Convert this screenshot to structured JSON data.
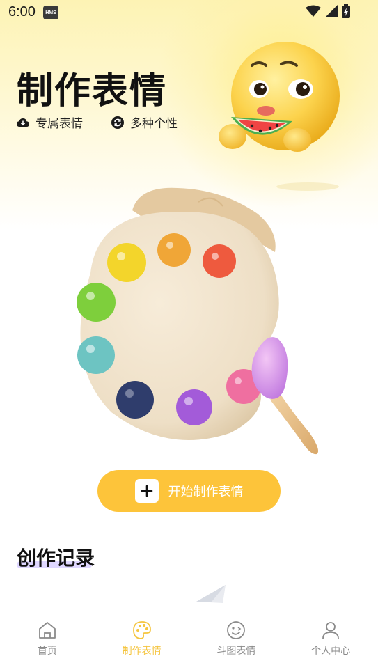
{
  "status_bar": {
    "time": "6:00",
    "badge": "HMS"
  },
  "hero": {
    "title": "制作表情",
    "features": [
      {
        "icon": "cloud-download-icon",
        "label": "专属表情"
      },
      {
        "icon": "refresh-circle-icon",
        "label": "多种个性"
      }
    ]
  },
  "start_button": {
    "label": "开始制作表情",
    "icon": "plus-icon"
  },
  "section": {
    "title": "创作记录"
  },
  "bottom_nav": {
    "items": [
      {
        "icon": "home-icon",
        "label": "首页",
        "active": false
      },
      {
        "icon": "palette-icon",
        "label": "制作表情",
        "active": true
      },
      {
        "icon": "smiley-icon",
        "label": "斗图表情",
        "active": false
      },
      {
        "icon": "person-icon",
        "label": "个人中心",
        "active": false
      }
    ]
  },
  "colors": {
    "accent": "#fdc43a",
    "active_nav": "#f5c53f",
    "inactive_nav": "#8a8a8a"
  }
}
